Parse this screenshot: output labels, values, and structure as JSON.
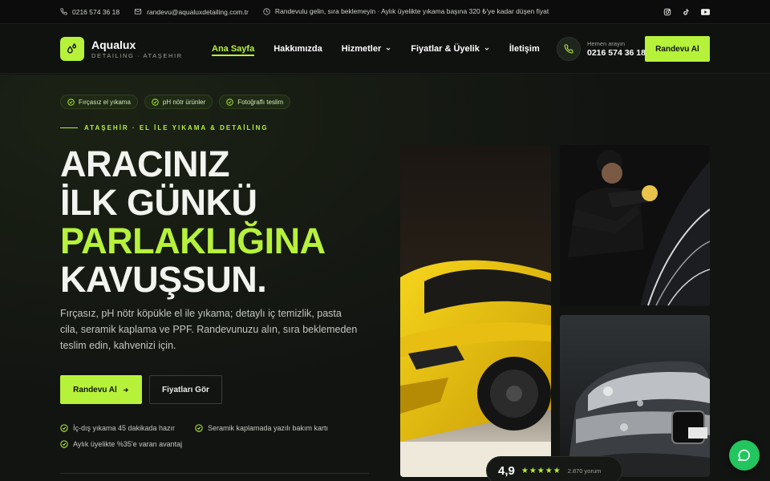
{
  "topbar": {
    "phone": "0216 574 36 18",
    "email": "randevu@aqualuxdetailing.com.tr",
    "notice": "Randevulu gelin, sıra beklemeyin · Aylık üyelikte yıkama başına 320 ₺'ye kadar düşen fiyat"
  },
  "brand": {
    "name": "Aqualux",
    "tagline": "DETAILING · ATAŞEHIR"
  },
  "nav": {
    "items": [
      {
        "label": "Ana Sayfa"
      },
      {
        "label": "Hakkımızda"
      },
      {
        "label": "Hizmetler"
      },
      {
        "label": "Fiyatlar & Üyelik"
      },
      {
        "label": "İletişim"
      }
    ]
  },
  "call": {
    "label": "Hemen arayın",
    "number": "0216 574 36 18"
  },
  "header_cta": "Randevu Al",
  "hero": {
    "pills": [
      "Fırçasız el yıkama",
      "pH nötr ürünler",
      "Fotoğraflı teslim"
    ],
    "eyebrow": "ATAŞEHİR · EL İLE YIKAMA & DETAİLİNG",
    "title_l1": "ARACINIZ",
    "title_l2": "İLK GÜNKÜ",
    "title_l3": "PARLAKLIĞINA",
    "title_l4": "KAVUŞSUN.",
    "description": "Fırçasız, pH nötr köpükle el ile yıkama; detaylı iç temizlik, pasta cila, seramik kaplama ve PPF. Randevunuzu alın, sıra beklemeden teslim edin, kahvenizi için.",
    "primary_btn": "Randevu Al",
    "secondary_btn": "Fiyatları Gör",
    "features": [
      "İç-dış yıkama 45 dakikada hazır",
      "Seramik kaplamada yazılı bakım kartı",
      "Aylık üyelikte %35'e varan avantaj"
    ]
  },
  "rating": {
    "score": "4,9",
    "stars": 5,
    "stars_text": "★★★★★",
    "reviews": "2.870 yorum"
  },
  "colors": {
    "accent": "#b6f23a",
    "bg": "#121412",
    "chat": "#22c55e"
  }
}
